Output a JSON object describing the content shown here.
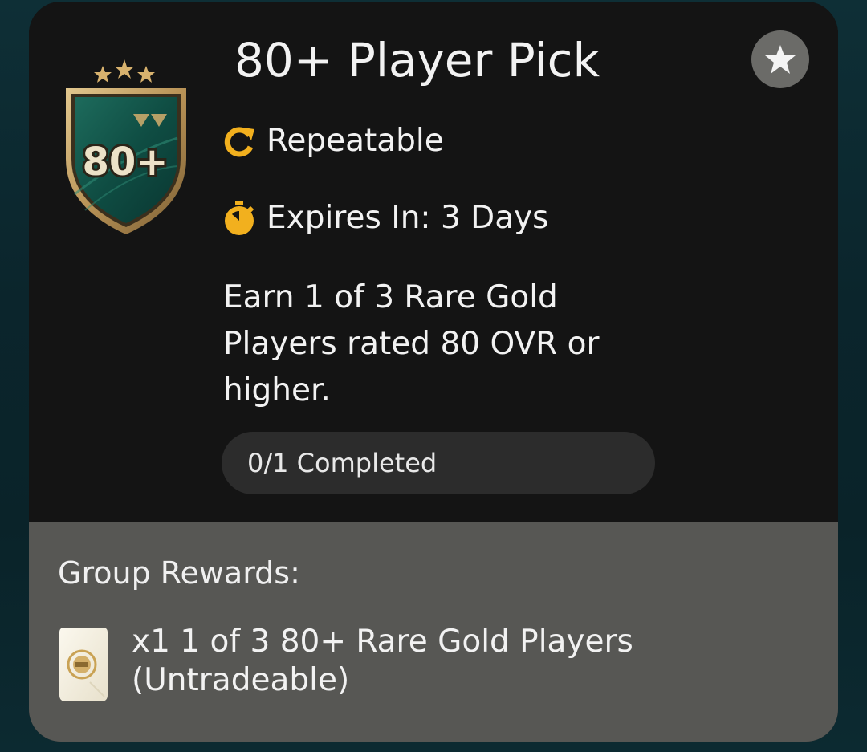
{
  "objective": {
    "badge_text": "80+",
    "title": "80+ Player Pick",
    "repeatable_label": "Repeatable",
    "expires_label": "Expires In: 3 Days",
    "description": "Earn 1 of 3 Rare Gold Players rated 80 OVR or higher.",
    "progress_text": "0/1 Completed",
    "progress_fraction": 0,
    "favorite_icon": "star-icon"
  },
  "rewards": {
    "title": "Group Rewards:",
    "items": [
      {
        "line1": "x1 1 of 3 80+ Rare Gold Players",
        "line2": "(Untradeable)",
        "icon": "player-pack-icon"
      }
    ]
  },
  "colors": {
    "accent": "#f2b01e",
    "card_top": "#141414",
    "card_bottom": "#575754",
    "pill": "#2c2c2c"
  }
}
